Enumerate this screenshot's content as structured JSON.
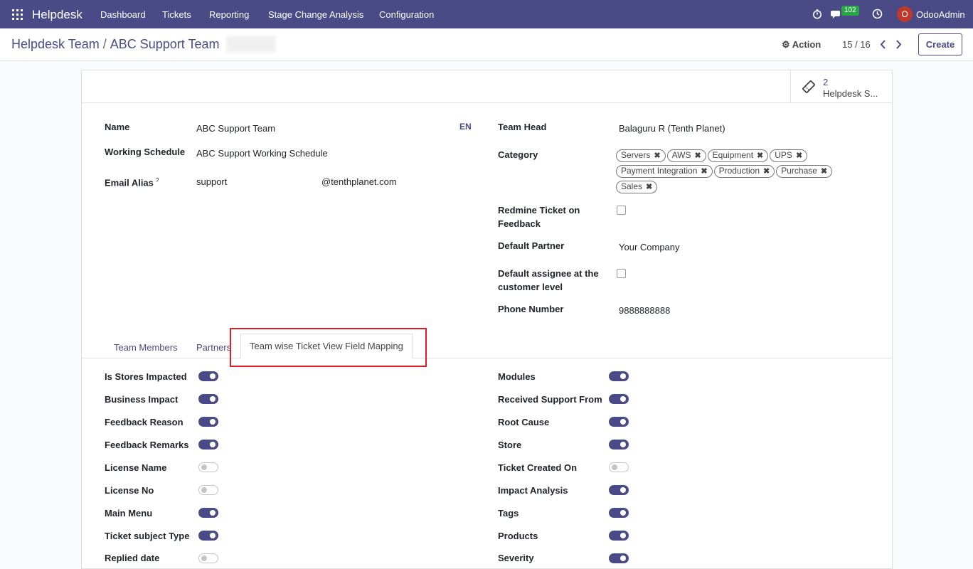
{
  "app": {
    "name": "Helpdesk"
  },
  "nav": {
    "menu": [
      "Dashboard",
      "Tickets",
      "Reporting",
      "Stage Change Analysis",
      "Configuration"
    ],
    "chat_badge": "102",
    "user_initial": "O",
    "user_name": "OdooAdmin"
  },
  "breadcrumb": {
    "parent": "Helpdesk Team",
    "separator": "/",
    "current": "ABC Support Team"
  },
  "toolbar": {
    "action_label": "Action",
    "pager": "15 / 16",
    "create_label": "Create"
  },
  "smart_button": {
    "count": "2",
    "label": "Helpdesk S..."
  },
  "form": {
    "name_label": "Name",
    "name_value": "ABC Support Team",
    "lang_badge": "EN",
    "schedule_label": "Working Schedule",
    "schedule_value": "ABC Support Working Schedule",
    "alias_label": "Email Alias",
    "alias_help": "?",
    "alias_value": "support",
    "alias_domain": "@tenthplanet.com",
    "team_head_label": "Team Head",
    "team_head_value": "Balaguru R (Tenth Planet)",
    "category_label": "Category",
    "categories": [
      "Servers",
      "AWS",
      "Equipment",
      "UPS",
      "Payment Integration",
      "Production",
      "Purchase",
      "Sales"
    ],
    "redmine_label": "Redmine Ticket on Feedback",
    "default_partner_label": "Default Partner",
    "default_partner_value": "Your Company",
    "default_assignee_label": "Default assignee at the customer level",
    "phone_label": "Phone Number",
    "phone_value": "9888888888"
  },
  "tabs": [
    "Team Members",
    "Partners",
    "Team wise Ticket View Field Mapping"
  ],
  "left_toggles": [
    {
      "label": "Is Stores Impacted",
      "on": true
    },
    {
      "label": "Business Impact",
      "on": true
    },
    {
      "label": "Feedback Reason",
      "on": true
    },
    {
      "label": "Feedback Remarks",
      "on": true
    },
    {
      "label": "License Name",
      "on": false
    },
    {
      "label": "License No",
      "on": false
    },
    {
      "label": "Main Menu",
      "on": true
    },
    {
      "label": "Ticket subject Type",
      "on": true
    },
    {
      "label": "Replied date",
      "on": false
    }
  ],
  "right_toggles": [
    {
      "label": "Modules",
      "on": true
    },
    {
      "label": "Received Support From",
      "on": true
    },
    {
      "label": "Root Cause",
      "on": true
    },
    {
      "label": "Store",
      "on": true
    },
    {
      "label": "Ticket Created On",
      "on": false
    },
    {
      "label": "Impact Analysis",
      "on": true
    },
    {
      "label": "Tags",
      "on": true
    },
    {
      "label": "Products",
      "on": true
    },
    {
      "label": "Severity",
      "on": true
    }
  ]
}
